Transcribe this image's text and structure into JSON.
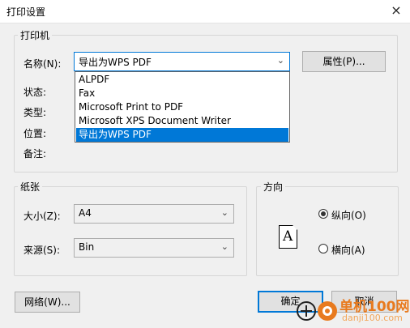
{
  "window": {
    "title": "打印设置",
    "close_icon": "×"
  },
  "printer_group": {
    "label": "打印机",
    "name_label": "名称(N):",
    "selected_printer": "导出为WPS PDF",
    "properties_button": "属性(P)...",
    "status_label": "状态:",
    "type_label": "类型:",
    "location_label": "位置:",
    "comment_label": "备注:",
    "dropdown_items": [
      "ALPDF",
      "Fax",
      "Microsoft Print to PDF",
      "Microsoft XPS Document Writer",
      "导出为WPS PDF"
    ],
    "dropdown_selected_index": 4
  },
  "paper_group": {
    "label": "纸张",
    "size_label": "大小(Z):",
    "size_value": "A4",
    "source_label": "来源(S):",
    "source_value": "Bin"
  },
  "orientation_group": {
    "label": "方向",
    "page_letter": "A",
    "portrait_label": "纵向(O)",
    "landscape_label": "横向(A)",
    "selected": "portrait"
  },
  "footer": {
    "network_button": "网络(W)...",
    "ok_button": "确定",
    "cancel_button": "取消"
  },
  "watermark": {
    "text1": "单机100网",
    "text2": "danji100.com"
  },
  "colors": {
    "accent": "#0078d7",
    "watermark": "#e87a1e"
  }
}
